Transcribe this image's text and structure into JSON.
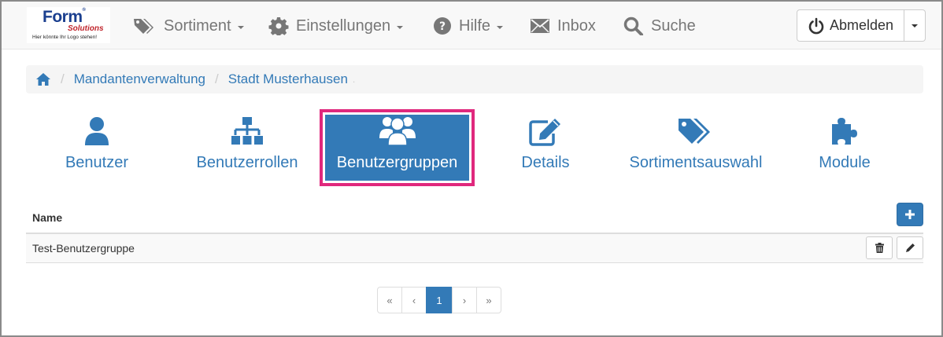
{
  "brand": {
    "logo_word": "Form",
    "logo_sub": "Solutions",
    "logo_tagline": "Hier könnte Ihr Logo stehen!"
  },
  "nav": {
    "items": [
      {
        "label": "Sortiment",
        "icon": "tags-icon",
        "dropdown": true
      },
      {
        "label": "Einstellungen",
        "icon": "gear-icon",
        "dropdown": true
      },
      {
        "label": "Hilfe",
        "icon": "question-circle-icon",
        "dropdown": true
      },
      {
        "label": "Inbox",
        "icon": "envelope-icon",
        "dropdown": false
      },
      {
        "label": "Suche",
        "icon": "search-icon",
        "dropdown": false
      }
    ],
    "logout_label": "Abmelden"
  },
  "breadcrumb": {
    "home_icon": "home-icon",
    "items": [
      "Mandantenverwaltung",
      "Stadt Musterhausen"
    ]
  },
  "tabs": [
    {
      "label": "Benutzer",
      "icon": "user-icon",
      "active": false
    },
    {
      "label": "Benutzerrollen",
      "icon": "sitemap-icon",
      "active": false
    },
    {
      "label": "Benutzergruppen",
      "icon": "users-icon",
      "active": true
    },
    {
      "label": "Details",
      "icon": "edit-icon",
      "active": false
    },
    {
      "label": "Sortimentsauswahl",
      "icon": "tags-icon",
      "active": false
    },
    {
      "label": "Module",
      "icon": "puzzle-icon",
      "active": false
    }
  ],
  "table": {
    "header_name": "Name",
    "add_icon": "plus-icon",
    "rows": [
      {
        "name": "Test-Benutzergruppe"
      }
    ]
  },
  "pagination": {
    "first": "«",
    "prev": "‹",
    "current": "1",
    "next": "›",
    "last": "»"
  },
  "colors": {
    "primary": "#337ab7",
    "highlight": "#e0287d",
    "nav_text": "#777777"
  }
}
